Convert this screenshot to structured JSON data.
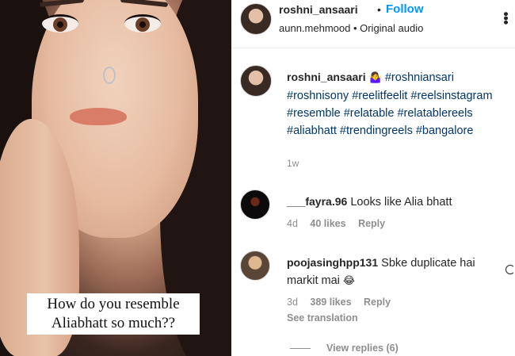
{
  "media": {
    "overlay_text": "How do you resemble Aliabhatt so much??"
  },
  "header": {
    "username": "roshni_ansaari",
    "separator": "•",
    "follow_label": "Follow",
    "subline": "aunn.mehmood • Original audio",
    "more_icon": "more-options-icon"
  },
  "caption": {
    "username": "roshni_ansaari",
    "emoji": "🤷‍♀️",
    "hashtags": [
      "#roshniansari",
      "#roshnisony",
      "#reelitfeelit",
      "#reelsinstagram",
      "#resemble",
      "#relatable",
      "#relatablereels",
      "#aliabhatt",
      "#trendingreels",
      "#bangalore"
    ],
    "time": "1w"
  },
  "comments": [
    {
      "username": "___fayra.96",
      "text": "Looks like Alia bhatt",
      "time": "4d",
      "likes": "40 likes",
      "reply_label": "Reply"
    },
    {
      "username": "poojasinghpp131",
      "text": "Sbke duplicate hai markit mai",
      "emoji": "😂",
      "time": "3d",
      "likes": "389 likes",
      "reply_label": "Reply",
      "translation_label": "See translation"
    }
  ],
  "view_replies_label": "View replies (6)",
  "colors": {
    "accent": "#0095f6",
    "hashtag": "#00376b",
    "muted": "#8e8e8e",
    "text": "#262626"
  }
}
